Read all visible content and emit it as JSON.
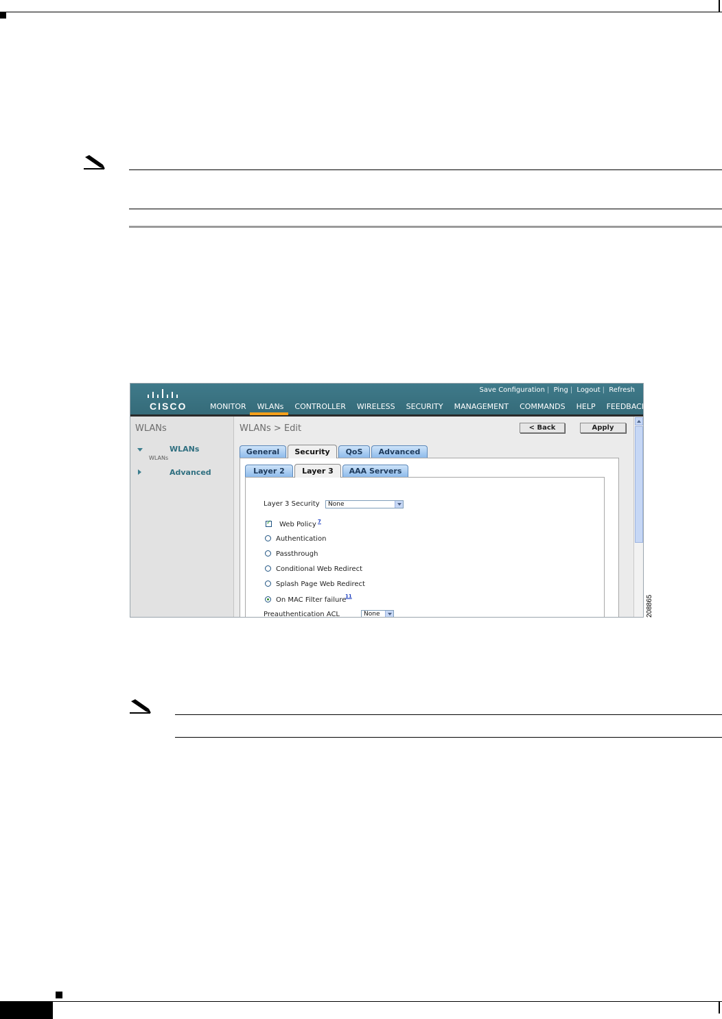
{
  "figure": {
    "number": "208865"
  },
  "wlc": {
    "brand": "CISCO",
    "top_links": [
      "Save Configuration",
      "Ping",
      "Logout",
      "Refresh"
    ],
    "nav": [
      "MONITOR",
      "WLANs",
      "CONTROLLER",
      "WIRELESS",
      "SECURITY",
      "MANAGEMENT",
      "COMMANDS",
      "HELP",
      "FEEDBACK"
    ],
    "active_nav": "WLANs",
    "sidebar": {
      "title": "WLANs",
      "items": [
        {
          "label": "WLANs",
          "sublabel": "WLANs",
          "expanded": true
        },
        {
          "label": "Advanced",
          "expanded": false
        }
      ]
    },
    "page_title": "WLANs > Edit",
    "buttons": {
      "back": "< Back",
      "apply": "Apply"
    },
    "tabs": [
      "General",
      "Security",
      "QoS",
      "Advanced"
    ],
    "active_tab": "Security",
    "subtabs": [
      "Layer 2",
      "Layer 3",
      "AAA Servers"
    ],
    "active_subtab": "Layer 3",
    "form": {
      "layer3_security_label": "Layer 3 Security",
      "layer3_security_value": "None",
      "web_policy_label": "Web Policy",
      "web_policy_checked": true,
      "web_policy_footnote": "7",
      "options": [
        {
          "label": "Authentication",
          "checked": false
        },
        {
          "label": "Passthrough",
          "checked": false
        },
        {
          "label": "Conditional Web Redirect",
          "checked": false
        },
        {
          "label": "Splash Page Web Redirect",
          "checked": false
        },
        {
          "label": "On MAC Filter failure",
          "checked": true,
          "footnote": "11"
        }
      ],
      "preauth_acl_label": "Preauthentication ACL",
      "preauth_acl_value": "None"
    }
  },
  "colors": {
    "header": "#3f7a8a",
    "nav_active": "#f6a01a",
    "tab": "#8ebbeb",
    "link": "#2f6f80"
  }
}
